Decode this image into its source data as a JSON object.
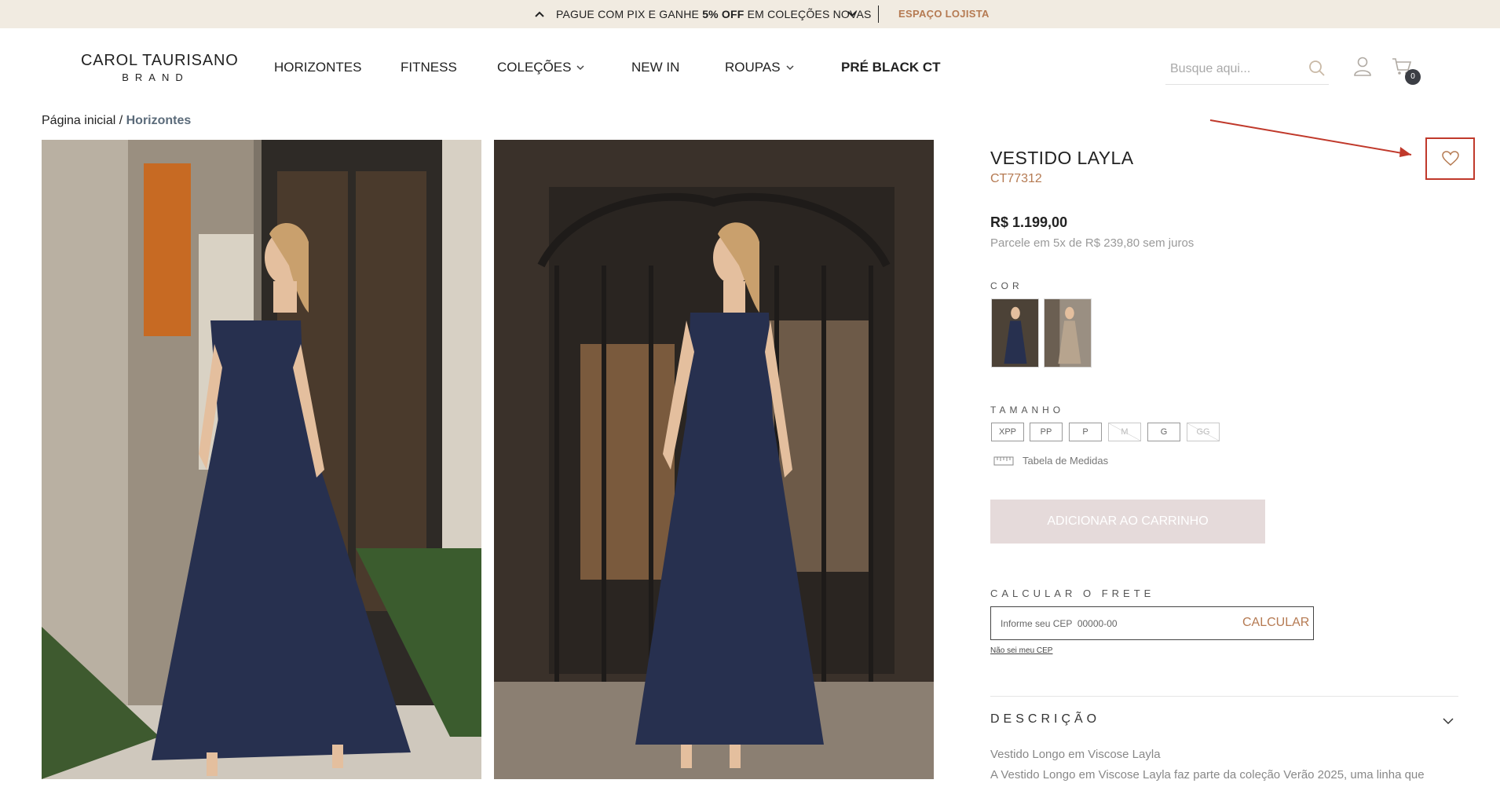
{
  "promo": {
    "text_before": "PAGUE COM PIX E GANHE ",
    "text_bold": "5% OFF",
    "text_after": " EM COLEÇÕES NOVAS",
    "lojista": "ESPAÇO LOJISTA"
  },
  "header": {
    "logo_line1": "CAROL TAURISANO",
    "logo_line2": "BRAND",
    "nav": [
      "HORIZONTES",
      "FITNESS",
      "COLEÇÕES",
      "NEW IN",
      "ROUPAS",
      "PRÉ BLACK CT"
    ],
    "search_placeholder": "Busque aqui...",
    "cart_count": "0"
  },
  "breadcrumb": {
    "home": "Página inicial",
    "separator": " / ",
    "current": "Horizontes"
  },
  "product": {
    "title": "VESTIDO LAYLA",
    "sku": "CT77312",
    "price": "R$ 1.199,00",
    "installments": "Parcele em 5x de R$ 239,80 sem juros",
    "color_label": "COR",
    "size_label": "TAMANHO",
    "sizes": [
      {
        "label": "XPP",
        "available": true
      },
      {
        "label": "PP",
        "available": true
      },
      {
        "label": "P",
        "available": true
      },
      {
        "label": "M",
        "available": false
      },
      {
        "label": "G",
        "available": true
      },
      {
        "label": "GG",
        "available": false
      }
    ],
    "size_table": "Tabela de Medidas",
    "add_to_cart": "ADICIONAR AO CARRINHO"
  },
  "shipping": {
    "label": "CALCULAR O FRETE",
    "placeholder": "Informe seu CEP  00000-00",
    "button": "CALCULAR",
    "help": "Não sei meu CEP"
  },
  "description": {
    "label": "DESCRIÇÃO",
    "line1": "Vestido Longo em Viscose Layla",
    "line2": "A Vestido Longo em Viscose Layla faz parte da coleção Verão 2025, uma linha que"
  },
  "colors": {
    "accent": "#b57a52",
    "promo_bg": "#f1ebe1",
    "annotation": "#c0392b",
    "dress": "#27304f"
  }
}
